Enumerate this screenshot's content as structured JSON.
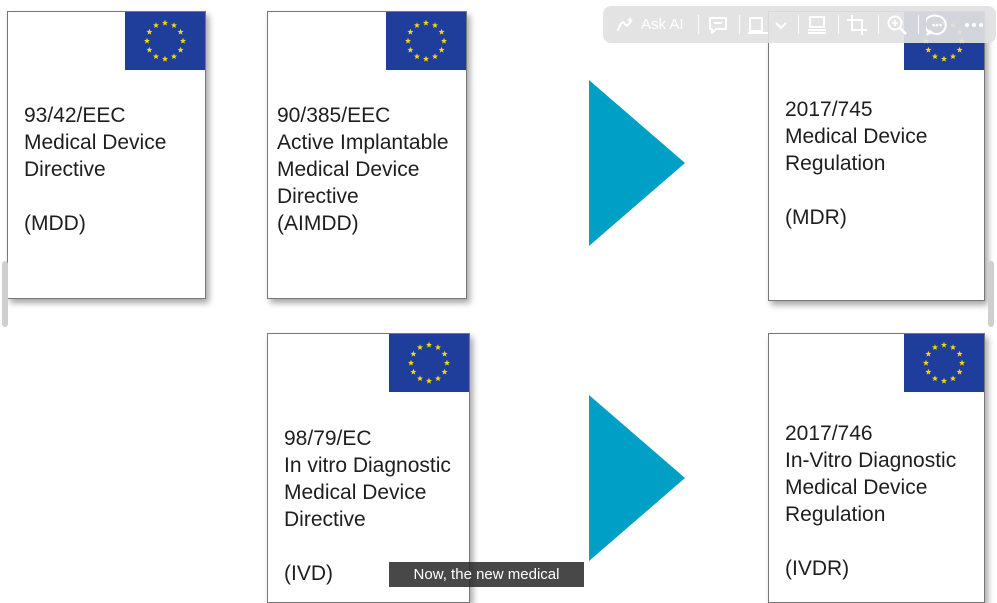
{
  "cards": [
    {
      "id": "mdd",
      "lines": [
        "93/42/EEC",
        "Medical Device",
        "Directive"
      ],
      "abbr": "(MDD)"
    },
    {
      "id": "aimdd",
      "lines": [
        "90/385/EEC",
        "Active Implantable",
        "Medical Device",
        "Directive",
        "(AIMDD)"
      ],
      "abbr": ""
    },
    {
      "id": "mdr",
      "lines": [
        "2017/745",
        "Medical Device",
        "Regulation"
      ],
      "abbr": "(MDR)"
    },
    {
      "id": "ivd",
      "lines": [
        "98/79/EC",
        "In vitro Diagnostic",
        "Medical Device",
        "Directive"
      ],
      "abbr": "(IVD)"
    },
    {
      "id": "ivdr",
      "lines": [
        "2017/746",
        "In-Vitro Diagnostic",
        "Medical Device",
        "Regulation"
      ],
      "abbr": "(IVDR)"
    }
  ],
  "toolbar": {
    "ask_ai_label": "Ask AI",
    "icons": [
      "ask-ai-icon",
      "comment-icon",
      "frame-icon",
      "chevron-down-icon",
      "align-icon",
      "crop-icon",
      "zoom-in-icon",
      "chat-icon",
      "more-icon"
    ]
  },
  "caption": {
    "text": "Now, the new medical"
  },
  "colors": {
    "flag_blue": "#1f3d9a",
    "star_yellow": "#f5d90a",
    "arrow_teal": "#00a0c6",
    "toolbar_bg": "#e1e1e1"
  }
}
